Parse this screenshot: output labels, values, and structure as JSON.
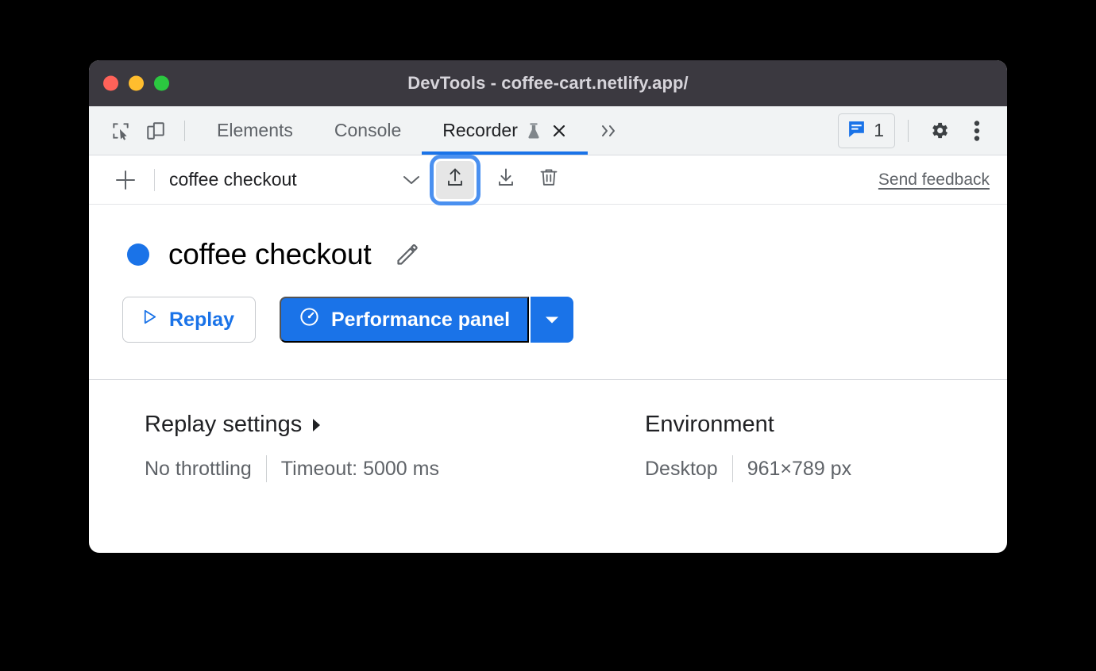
{
  "window": {
    "title": "DevTools - coffee-cart.netlify.app/",
    "traffic_lights": [
      {
        "name": "close",
        "color": "#ff6259"
      },
      {
        "name": "minimize",
        "color": "#ffbd2e"
      },
      {
        "name": "maximize",
        "color": "#2bc840"
      }
    ]
  },
  "tabstrip": {
    "inspect_icon": "inspect-element-icon",
    "device_icon": "device-toolbar-icon",
    "tabs": [
      {
        "label": "Elements",
        "active": false
      },
      {
        "label": "Console",
        "active": false
      },
      {
        "label": "Recorder",
        "active": true,
        "experimental": true,
        "closable": true
      }
    ],
    "more_tabs_icon": "chevron-double-right-icon",
    "issues": {
      "icon": "message-icon",
      "count": "1"
    },
    "settings_icon": "gear-icon",
    "menu_icon": "three-dots-icon"
  },
  "recorder_toolbar": {
    "add_icon": "plus-icon",
    "recording_name": "coffee checkout",
    "dropdown_icon": "chevron-down-icon",
    "export_icon": "upload-icon",
    "import_icon": "download-icon",
    "delete_icon": "trash-icon",
    "feedback_label": "Send feedback",
    "focused_button": "export"
  },
  "recording": {
    "status_dot_color": "#1a73e8",
    "title": "coffee checkout",
    "edit_icon": "pencil-icon",
    "replay_label": "Replay",
    "replay_icon": "play-triangle-icon",
    "performance_label": "Performance panel",
    "performance_icon": "gauge-icon",
    "performance_caret_icon": "caret-down-icon"
  },
  "settings": {
    "replay": {
      "heading": "Replay settings",
      "expand_icon": "caret-right-icon",
      "throttling": "No throttling",
      "timeout": "Timeout: 5000 ms"
    },
    "environment": {
      "heading": "Environment",
      "device": "Desktop",
      "viewport": "961×789 px"
    }
  },
  "colors": {
    "accent_blue": "#1a73e8",
    "titlebar_bg": "#3b3940",
    "tabstrip_bg": "#f1f3f4",
    "focus_ring": "#4a90f0"
  }
}
